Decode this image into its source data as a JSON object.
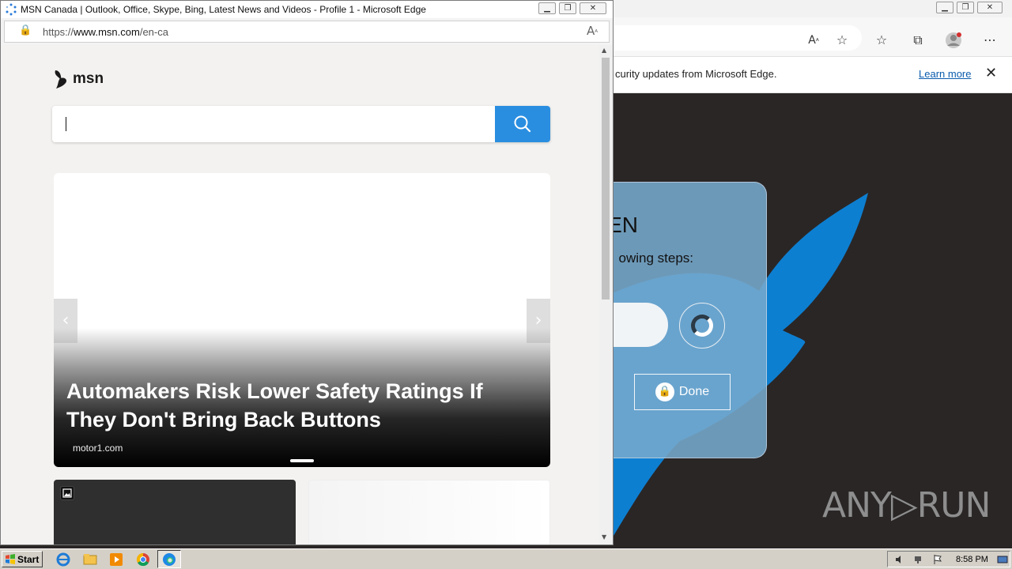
{
  "background_window": {
    "infobar_text": "curity updates from Microsoft Edge.",
    "learn_more": "Learn more",
    "close_glyph": "✕",
    "dialog": {
      "title": "EN",
      "subtitle": "owing steps:",
      "done_label": "Done"
    },
    "watermark": "ANY▷RUN"
  },
  "popup": {
    "title": "MSN Canada | Outlook, Office, Skype, Bing, Latest News and Videos - Profile 1 - Microsoft Edge",
    "url_prefix": "https://",
    "url_domain": "www.msn.com",
    "url_path": "/en-ca",
    "logo_text": "msn",
    "search_placeholder": "",
    "hero": {
      "headline": "Automakers Risk Lower Safety Ratings If They Don't Bring Back Buttons",
      "source": "motor1.com"
    }
  },
  "taskbar": {
    "start_label": "Start",
    "clock": "8:58 PM",
    "pinned": [
      "internet-explorer-icon",
      "folder-icon",
      "media-player-icon",
      "chrome-icon",
      "edge-icon"
    ]
  },
  "colors": {
    "search_button": "#2a8ee0",
    "learn_more_link": "#0b5cad",
    "dialog_bg": "#76aacd",
    "bird_blue": "#0d7fd1"
  }
}
